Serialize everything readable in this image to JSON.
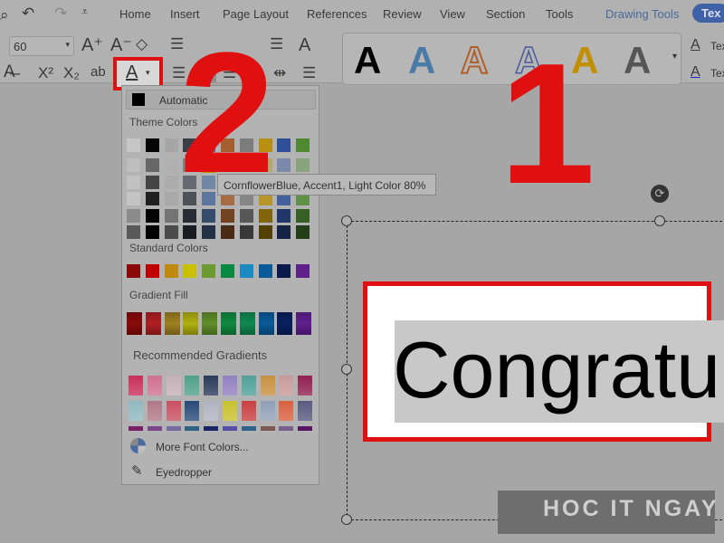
{
  "menu_tabs": [
    "Home",
    "Insert",
    "Page Layout",
    "References",
    "Review",
    "View",
    "Section",
    "Tools"
  ],
  "drawing_tools": "Drawing Tools",
  "text_tab": "Tex",
  "font_size": "60",
  "side_labels": [
    "Tex",
    "Tex"
  ],
  "menu": {
    "automatic": "Automatic",
    "theme_colors": "Theme Colors",
    "standard_colors": "Standard Colors",
    "gradient_fill": "Gradient Fill",
    "recommended_gradients": "Recommended Gradients",
    "more_colors": "More Font Colors...",
    "eyedropper": "Eyedropper",
    "theme_top": [
      "#c6c6c6",
      "#050505",
      "#a6a6a6",
      "#3a3f47",
      "#4b6c9c",
      "#a35f2e",
      "#7c7c7c",
      "#b88f10",
      "#2f4f98",
      "#4f8a33"
    ],
    "standard": [
      "#8a0a0a",
      "#c00000",
      "#c08a10",
      "#c8c000",
      "#6a9a30",
      "#0a8a40",
      "#1a8ac0",
      "#0a5a9a",
      "#0a1a4a",
      "#60208a"
    ],
    "gradient": [
      "#8a0a0a",
      "#b02020",
      "#a08020",
      "#b0b010",
      "#60902a",
      "#108a40",
      "#108a50",
      "#0a5a9a",
      "#0a2060",
      "#602090"
    ],
    "recommended": [
      [
        "#c8305a",
        "#d07090",
        "#c4b0b6",
        "#50a08a",
        "#2a3a5a",
        "#9080c0",
        "#50a098",
        "#c89040",
        "#c89a9a",
        "#902050"
      ],
      [
        "#90b8c0",
        "#b07888",
        "#c85060",
        "#284a78",
        "#b0b4c0",
        "#c8c030",
        "#c84040",
        "#90a0b8",
        "#d86040",
        "#585a80"
      ]
    ]
  },
  "tooltip": "CornflowerBlue, Accent1, Light Color 80%",
  "document_text": "Congratul",
  "annotations": [
    "1",
    "2"
  ],
  "watermark": "HOC IT NGAY",
  "accent": "#e01010"
}
